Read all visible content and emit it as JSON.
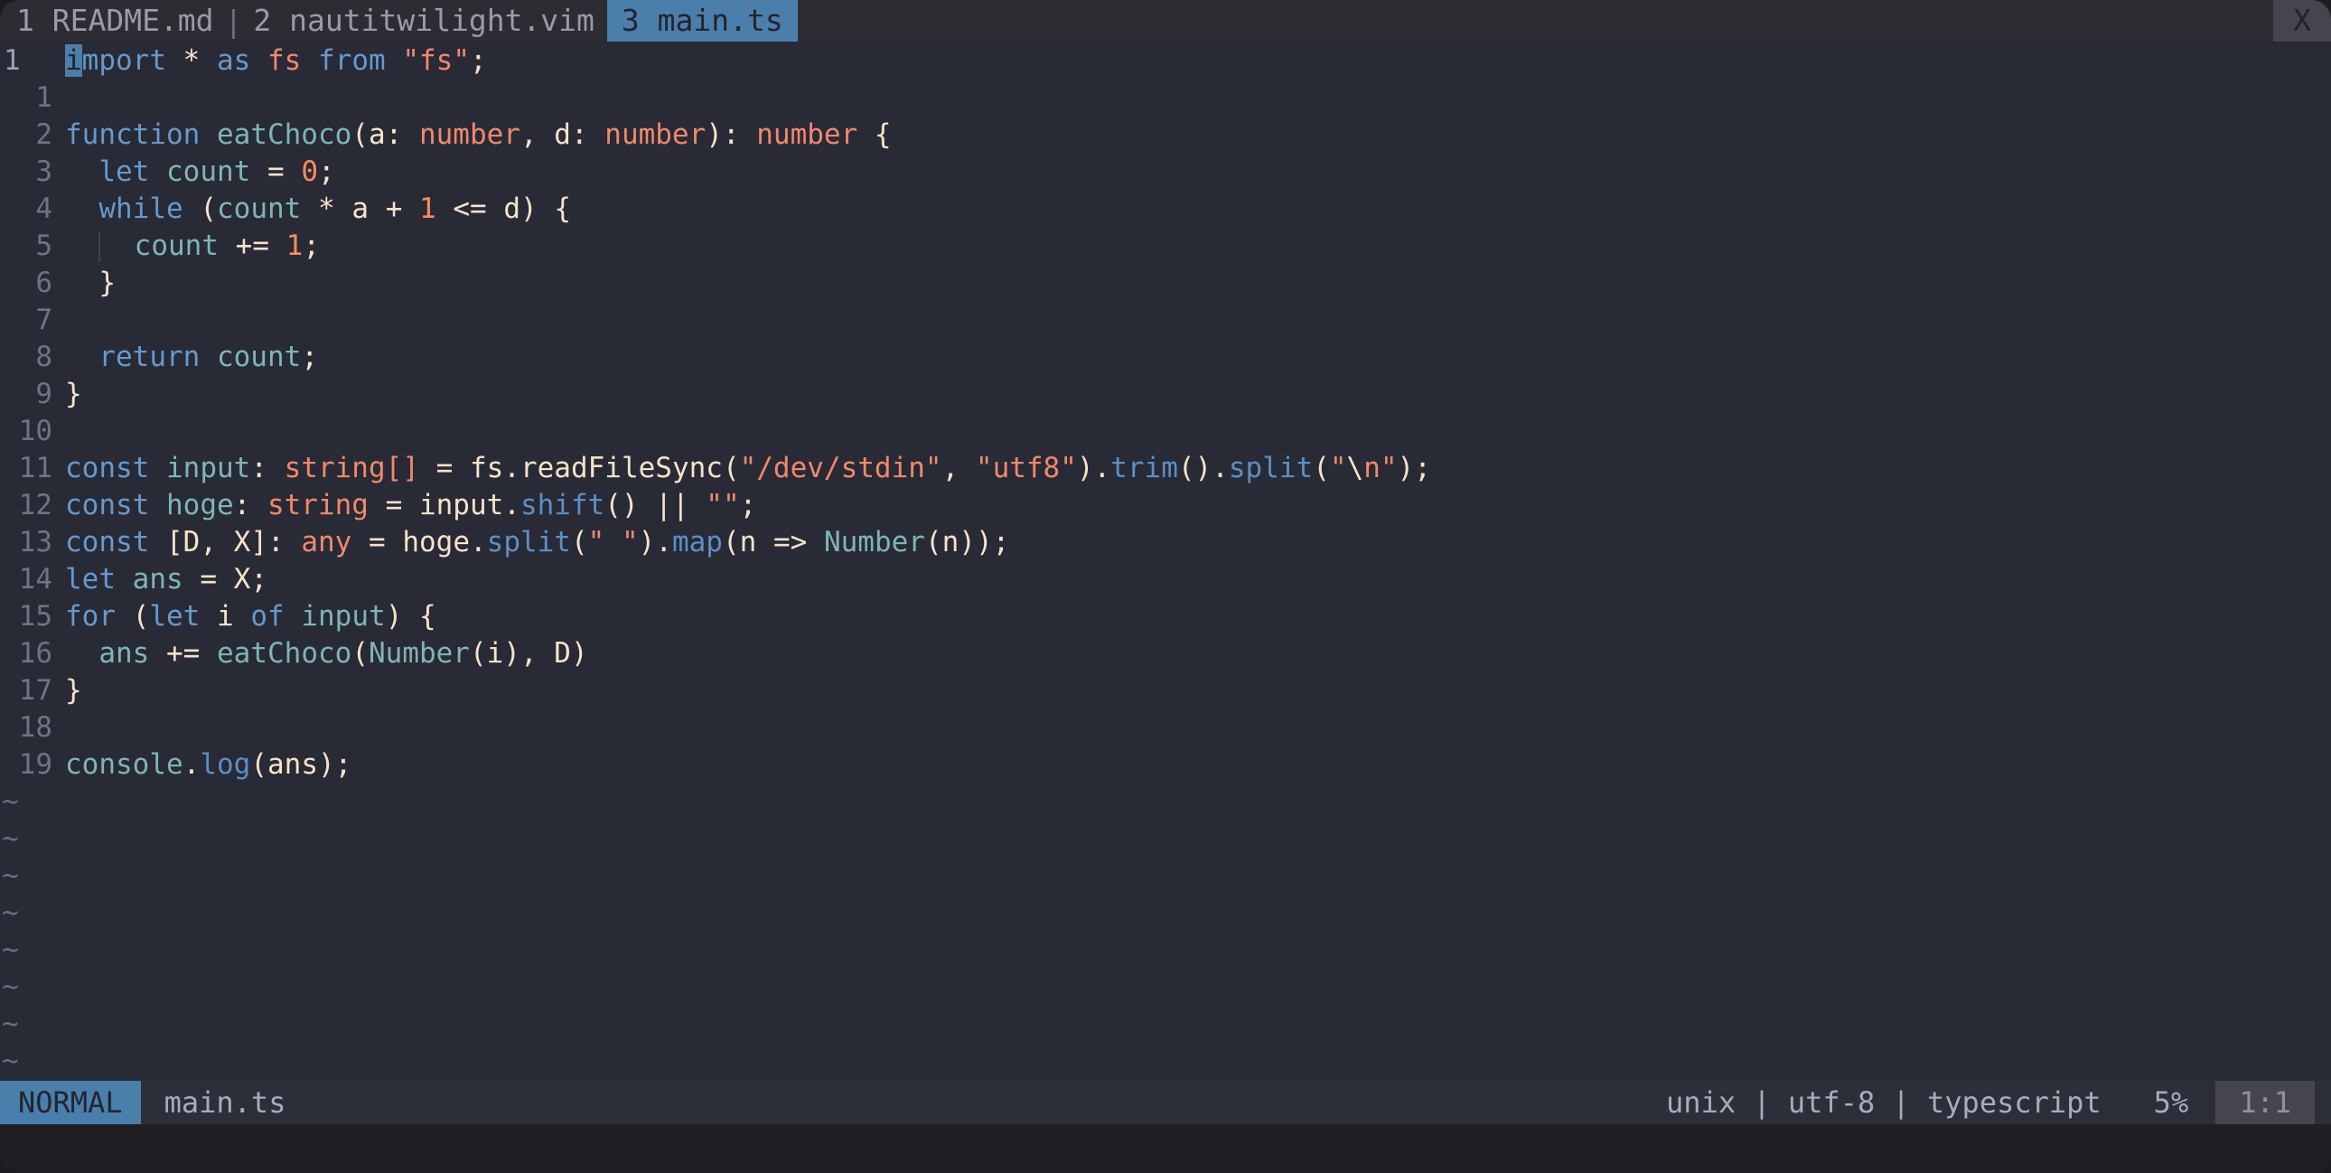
{
  "window": {
    "title": "main.ts",
    "bg": "#282a36",
    "tabline_bg": "#2c2c32",
    "accent": "#4a7fab"
  },
  "tabline": {
    "tabs": [
      {
        "index": "1",
        "label": "README.md",
        "active": false
      },
      {
        "index": "2",
        "label": "nautitwilight.vim",
        "active": false
      },
      {
        "index": "3",
        "label": "main.ts",
        "active": true
      }
    ],
    "separator": "|",
    "tab1_text": "1 README.md",
    "tab2_text": "2 nautitwilight.vim",
    "tab3_text": "3 main.ts",
    "close_label": "X"
  },
  "editor": {
    "cursor_line": 1,
    "cursor_col": 1,
    "cursor_char": "i",
    "gutter_absolute": "1",
    "lines": [
      {
        "num": "1",
        "rel": ""
      },
      {
        "num": "1",
        "rel": "1"
      },
      {
        "num": "2",
        "rel": "2"
      },
      {
        "num": "3",
        "rel": "3"
      },
      {
        "num": "4",
        "rel": "4"
      },
      {
        "num": "5",
        "rel": "5"
      },
      {
        "num": "6",
        "rel": "6"
      },
      {
        "num": "7",
        "rel": "7"
      },
      {
        "num": "8",
        "rel": "8"
      },
      {
        "num": "9",
        "rel": "9"
      },
      {
        "num": "10",
        "rel": "10"
      },
      {
        "num": "11",
        "rel": "11"
      },
      {
        "num": "12",
        "rel": "12"
      },
      {
        "num": "13",
        "rel": "13"
      },
      {
        "num": "14",
        "rel": "14"
      },
      {
        "num": "15",
        "rel": "15"
      },
      {
        "num": "16",
        "rel": "16"
      },
      {
        "num": "17",
        "rel": "17"
      },
      {
        "num": "18",
        "rel": "18"
      },
      {
        "num": "19",
        "rel": "19"
      }
    ],
    "source_text": [
      "import * as fs from \"fs\";",
      "",
      "function eatChoco(a: number, d: number): number {",
      "  let count = 0;",
      "  while (count * a + 1 <= d) {",
      "    count += 1;",
      "  }",
      "",
      "  return count;",
      "}",
      "",
      "const input: string[] = fs.readFileSync(\"/dev/stdin\", \"utf8\").trim().split(\"\\n\");",
      "const hoge: string = input.shift() || \"\";",
      "const [D, X]: any = hoge.split(\" \").map(n => Number(n));",
      "let ans = X;",
      "for (let i of input) {",
      "  ans += eatChoco(Number(i), D)",
      "}",
      "",
      "console.log(ans);"
    ],
    "empty_marker": "~",
    "empty_marker_count": 8
  },
  "statusline": {
    "mode": "NORMAL",
    "filename": "main.ts",
    "fileformat": "unix",
    "encoding": "utf-8",
    "filetype": "typescript",
    "separator": "|",
    "info": "unix | utf-8 | typescript",
    "percent": "5%",
    "position": "1:1"
  }
}
